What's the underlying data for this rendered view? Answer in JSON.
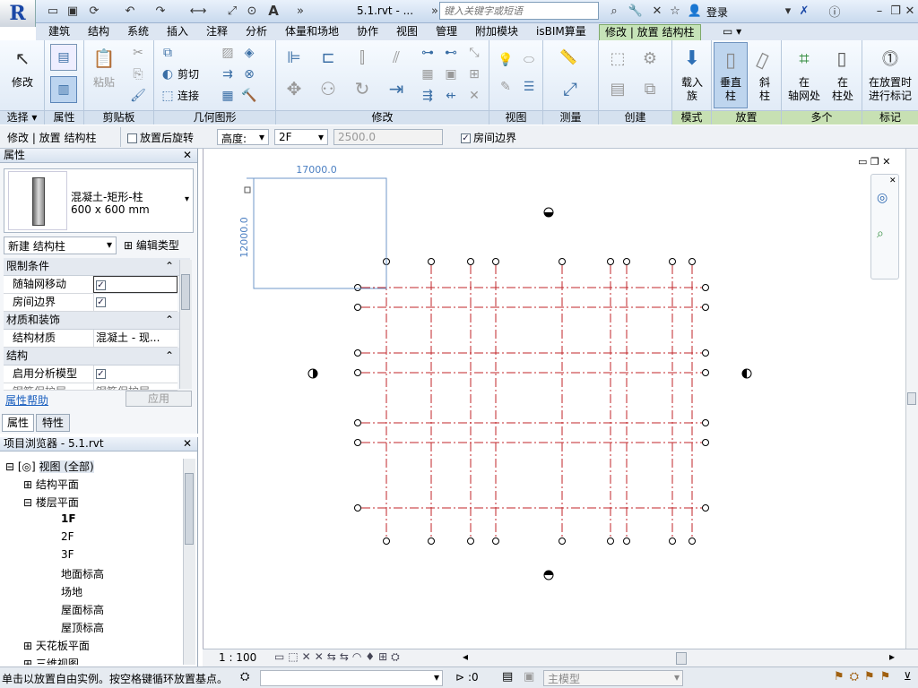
{
  "app": {
    "logo": "R",
    "document_title": "5.1.rvt - ...",
    "search_placeholder": "键入关键字或短语",
    "login": "登录"
  },
  "tabs": [
    {
      "label": "建筑"
    },
    {
      "label": "结构"
    },
    {
      "label": "系统"
    },
    {
      "label": "插入"
    },
    {
      "label": "注释"
    },
    {
      "label": "分析"
    },
    {
      "label": "体量和场地"
    },
    {
      "label": "协作"
    },
    {
      "label": "视图"
    },
    {
      "label": "管理"
    },
    {
      "label": "附加模块"
    },
    {
      "label": "isBIM算量"
    },
    {
      "label": "修改 | 放置 结构柱"
    }
  ],
  "ribbon": {
    "modify": "修改",
    "paste": "粘贴",
    "cut": "剪切",
    "join": "连接",
    "load_family": "载入\n族",
    "vertical_column": "垂直\n柱",
    "slanted_column": "斜\n柱",
    "at_grids": "在\n轴网处",
    "at_columns": "在\n柱处",
    "tag_on_placement": "在放置时\n进行标记",
    "groups": {
      "select": "选择",
      "properties": "属性",
      "clipboard": "剪贴板",
      "geometry": "几何图形",
      "modify": "修改",
      "view": "视图",
      "measure": "测量",
      "create": "创建",
      "mode": "模式",
      "placement": "放置",
      "multiple": "多个",
      "tag": "标记"
    }
  },
  "options_bar": {
    "context": "修改 | 放置 结构柱",
    "rotate_after": "放置后旋转",
    "height_mode": "高度:",
    "level": "2F",
    "height_value": "2500.0",
    "room_bounding": "房间边界"
  },
  "properties": {
    "title": "属性",
    "type_name": "混凝土-矩形-柱",
    "type_size": "600 x 600 mm",
    "instance_selector": "新建 结构柱",
    "edit_type": "编辑类型",
    "sections": [
      {
        "label": "限制条件"
      },
      {
        "label": "材质和装饰"
      },
      {
        "label": "结构"
      }
    ],
    "rows": [
      {
        "label": "随轴网移动",
        "checked": true
      },
      {
        "label": "房间边界",
        "checked": true
      },
      {
        "label": "结构材质",
        "value": "混凝土 - 现..."
      },
      {
        "label": "启用分析模型",
        "checked": true
      },
      {
        "label": "钢筋保护层...",
        "value": "钢筋保护层..."
      }
    ],
    "help": "属性帮助",
    "apply": "应用",
    "tab_properties": "属性",
    "tab_features": "特性"
  },
  "project_browser": {
    "title": "项目浏览器 - 5.1.rvt",
    "nodes": [
      {
        "label": "视图 (全部)"
      },
      {
        "label": "结构平面"
      },
      {
        "label": "楼层平面"
      },
      {
        "label": "1F"
      },
      {
        "label": "2F"
      },
      {
        "label": "3F"
      },
      {
        "label": "地面标高"
      },
      {
        "label": "场地"
      },
      {
        "label": "屋面标高"
      },
      {
        "label": "屋顶标高"
      },
      {
        "label": "天花板平面"
      },
      {
        "label": "三维视图"
      }
    ]
  },
  "canvas": {
    "dim_width": "17000.0",
    "dim_height": "12000.0",
    "vertical_grid_x": [
      430,
      480,
      524,
      552,
      626,
      680,
      698,
      749,
      771
    ],
    "horizontal_grid_y": [
      321,
      343,
      394,
      416,
      472,
      494,
      567
    ]
  },
  "view_control_bar": {
    "scale": "1 : 100"
  },
  "status": {
    "message": "单击以放置自由实例。按空格键循环放置基点。",
    "zero": ":0",
    "model": "主模型"
  }
}
